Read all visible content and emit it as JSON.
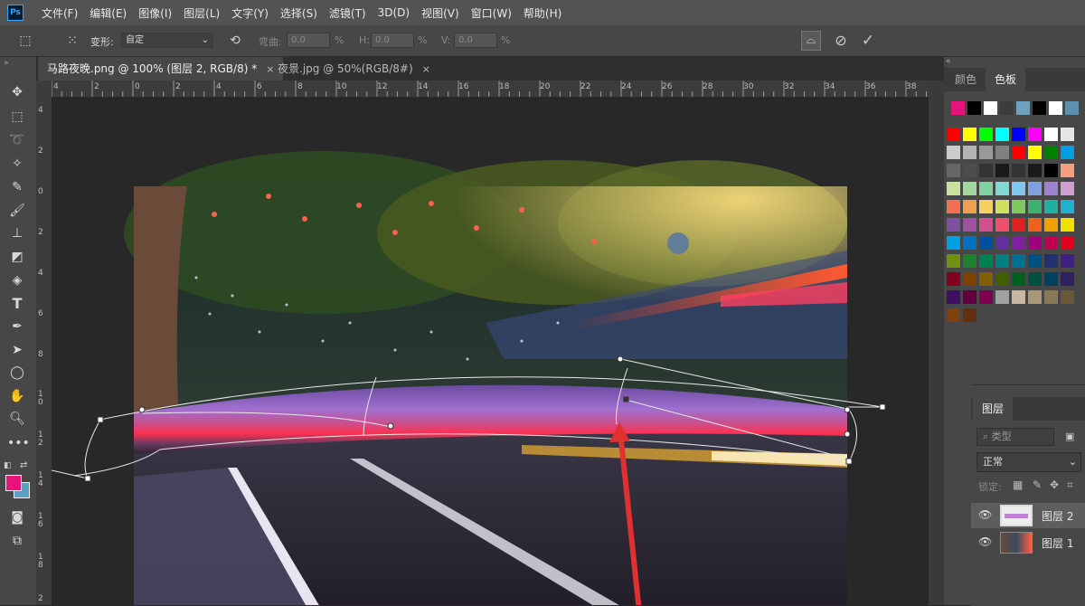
{
  "app": {
    "logo_text": "Ps"
  },
  "menu": [
    "文件(F)",
    "编辑(E)",
    "图像(I)",
    "图层(L)",
    "文字(Y)",
    "选择(S)",
    "滤镜(T)",
    "3D(D)",
    "视图(V)",
    "窗口(W)",
    "帮助(H)"
  ],
  "options": {
    "transform_label": "变形:",
    "transform_value": "自定",
    "bend_label": "弯曲:",
    "bend_value": "0.0",
    "h_label": "H:",
    "h_value": "0.0",
    "v_label": "V:",
    "v_value": "0.0",
    "percent": "%"
  },
  "tabs": [
    {
      "label": "马路夜晚.png @ 100% (图层 2, RGB/8) *",
      "close": "×"
    },
    {
      "label": "夜景.jpg @ 50%(RGB/8#)",
      "close": "×"
    }
  ],
  "ruler_h": [
    "4",
    "2",
    "0",
    "2",
    "4",
    "6",
    "8",
    "10",
    "12",
    "14",
    "16",
    "18",
    "20",
    "22",
    "24",
    "26",
    "28",
    "30",
    "32",
    "34",
    "36",
    "38"
  ],
  "ruler_v": [
    "4",
    "2",
    "0",
    "2",
    "4",
    "6",
    "8",
    "1 0",
    "1 2",
    "1 4",
    "1 6",
    "1 8",
    "2"
  ],
  "swatch_panel": {
    "tab_color": "颜色",
    "tab_swatches": "色板"
  },
  "swatches": {
    "recent": [
      "#e8137a",
      "#000000",
      "#ffffff",
      "#3c3c3c",
      "#6fa0c0",
      "#000000",
      "#ffffff",
      "#5a90b0"
    ],
    "rows": [
      [
        "#ff0000",
        "#ffff00",
        "#00ff00",
        "#00ffff",
        "#0000ff",
        "#ff00ff",
        "#ffffff",
        "#e6e6e6"
      ],
      [
        "#cccccc",
        "#b3b3b3",
        "#999999",
        "#808080",
        "#ff0000",
        "#ffff00",
        "#008000",
        "#00a0e0"
      ],
      [
        "#666666",
        "#4d4d4d",
        "#333333",
        "#1a1a1a",
        "#333333",
        "#1a1a1a",
        "#000000",
        "#f5a07a"
      ],
      [
        "#c8e0a0",
        "#a0d8a0",
        "#80d0a0",
        "#80d8d0",
        "#80c8f0",
        "#80a0e0",
        "#a080d0",
        "#d0a0d0"
      ],
      [
        "#f07050",
        "#f0a050",
        "#f8d060",
        "#d0e060",
        "#80c860",
        "#40b070",
        "#20b0a0",
        "#20b0d0"
      ],
      [
        "#8050a0",
        "#a050a0",
        "#d05090",
        "#f05070",
        "#e02020",
        "#f06020",
        "#f0a000",
        "#f0e000"
      ],
      [
        "#00a0e0",
        "#0070c0",
        "#0050a0",
        "#6030a0",
        "#8020a0",
        "#a00080",
        "#c00050",
        "#e00020"
      ],
      [
        "#709010",
        "#208030",
        "#008050",
        "#008080",
        "#007090",
        "#005080",
        "#203070",
        "#402080"
      ],
      [
        "#800020",
        "#804000",
        "#806000",
        "#406000",
        "#006020",
        "#005040",
        "#004060",
        "#302060"
      ],
      [
        "#401060",
        "#600040",
        "#800050",
        "#a0a0a0",
        "#c8b8a0",
        "#a89878",
        "#887858",
        "#685838"
      ],
      [
        "#804010",
        "#603010"
      ]
    ]
  },
  "layers": {
    "tab": "图层",
    "filter_placeholder": "类型",
    "blend_mode": "正常",
    "lock_label": "锁定:",
    "items": [
      {
        "name": "图层 2",
        "selected": true
      },
      {
        "name": "图层 1",
        "selected": false
      }
    ]
  },
  "colors": {
    "foreground": "#e8137a",
    "background": "#5aa0c0"
  }
}
